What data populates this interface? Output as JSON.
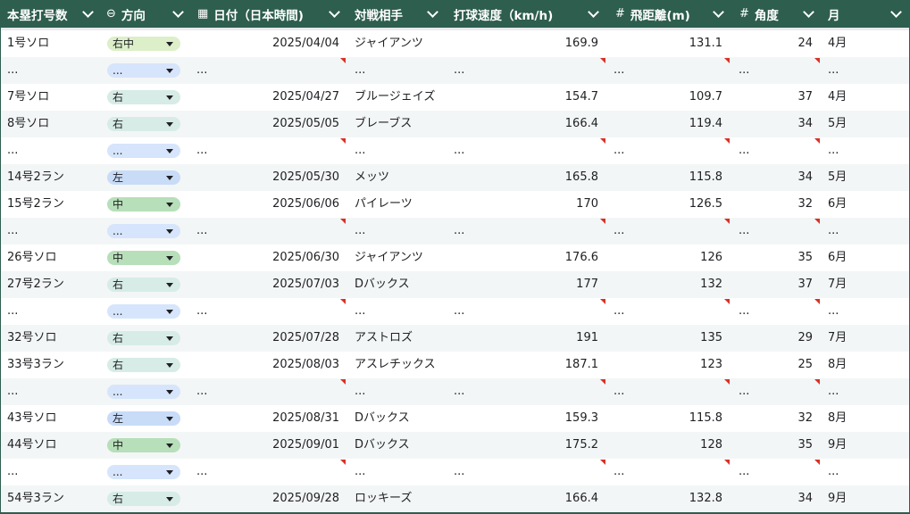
{
  "columns": [
    {
      "label": "本塁打号数",
      "icon": ""
    },
    {
      "label": "方向",
      "icon": "⊖"
    },
    {
      "label": "日付（日本時間)",
      "icon": "▦"
    },
    {
      "label": "対戦相手",
      "icon": ""
    },
    {
      "label": "打球速度（km/h)",
      "icon": ""
    },
    {
      "label": "飛距離(m)",
      "icon": "#"
    },
    {
      "label": "角度",
      "icon": "#"
    },
    {
      "label": "月",
      "icon": ""
    }
  ],
  "direction_colors": {
    "右": "#d7ece6",
    "右中": "#dcefc9",
    "中": "#b7dfb9",
    "左": "#c8dcf8",
    "...": "#d6e5fb"
  },
  "rows": [
    {
      "no": "1号ソロ",
      "dir": "右中",
      "date": "2025/04/04",
      "opp": "ジャイアンツ",
      "speed": "169.9",
      "dist": "131.1",
      "angle": "24",
      "month": "4月"
    },
    {
      "ellipsis": "..."
    },
    {
      "no": "7号ソロ",
      "dir": "右",
      "date": "2025/04/27",
      "opp": "ブルージェイズ",
      "speed": "154.7",
      "dist": "109.7",
      "angle": "37",
      "month": "4月"
    },
    {
      "no": "8号ソロ",
      "dir": "右",
      "date": "2025/05/05",
      "opp": "ブレーブス",
      "speed": "166.4",
      "dist": "119.4",
      "angle": "34",
      "month": "5月"
    },
    {
      "ellipsis": "..."
    },
    {
      "no": "14号2ラン",
      "dir": "左",
      "date": "2025/05/30",
      "opp": "メッツ",
      "speed": "165.8",
      "dist": "115.8",
      "angle": "34",
      "month": "5月"
    },
    {
      "no": "15号2ラン",
      "dir": "中",
      "date": "2025/06/06",
      "opp": "パイレーツ",
      "speed": "170",
      "dist": "126.5",
      "angle": "32",
      "month": "6月"
    },
    {
      "ellipsis": "..."
    },
    {
      "no": "26号ソロ",
      "dir": "中",
      "date": "2025/06/30",
      "opp": "ジャイアンツ",
      "speed": "176.6",
      "dist": "126",
      "angle": "35",
      "month": "6月"
    },
    {
      "no": "27号2ラン",
      "dir": "右",
      "date": "2025/07/03",
      "opp": "Dバックス",
      "speed": "177",
      "dist": "132",
      "angle": "37",
      "month": "7月"
    },
    {
      "ellipsis": "..."
    },
    {
      "no": "32号ソロ",
      "dir": "右",
      "date": "2025/07/28",
      "opp": "アストロズ",
      "speed": "191",
      "dist": "135",
      "angle": "29",
      "month": "7月"
    },
    {
      "no": "33号3ラン",
      "dir": "右",
      "date": "2025/08/03",
      "opp": "アスレチックス",
      "speed": "187.1",
      "dist": "123",
      "angle": "25",
      "month": "8月"
    },
    {
      "ellipsis": "..."
    },
    {
      "no": "43号ソロ",
      "dir": "左",
      "date": "2025/08/31",
      "opp": "Dバックス",
      "speed": "159.3",
      "dist": "115.8",
      "angle": "32",
      "month": "8月"
    },
    {
      "no": "44号ソロ",
      "dir": "中",
      "date": "2025/09/01",
      "opp": "Dバックス",
      "speed": "175.2",
      "dist": "128",
      "angle": "35",
      "month": "9月"
    },
    {
      "ellipsis": "..."
    },
    {
      "no": "54号3ラン",
      "dir": "右",
      "date": "2025/09/28",
      "opp": "ロッキーズ",
      "speed": "166.4",
      "dist": "132.8",
      "angle": "34",
      "month": "9月"
    }
  ]
}
